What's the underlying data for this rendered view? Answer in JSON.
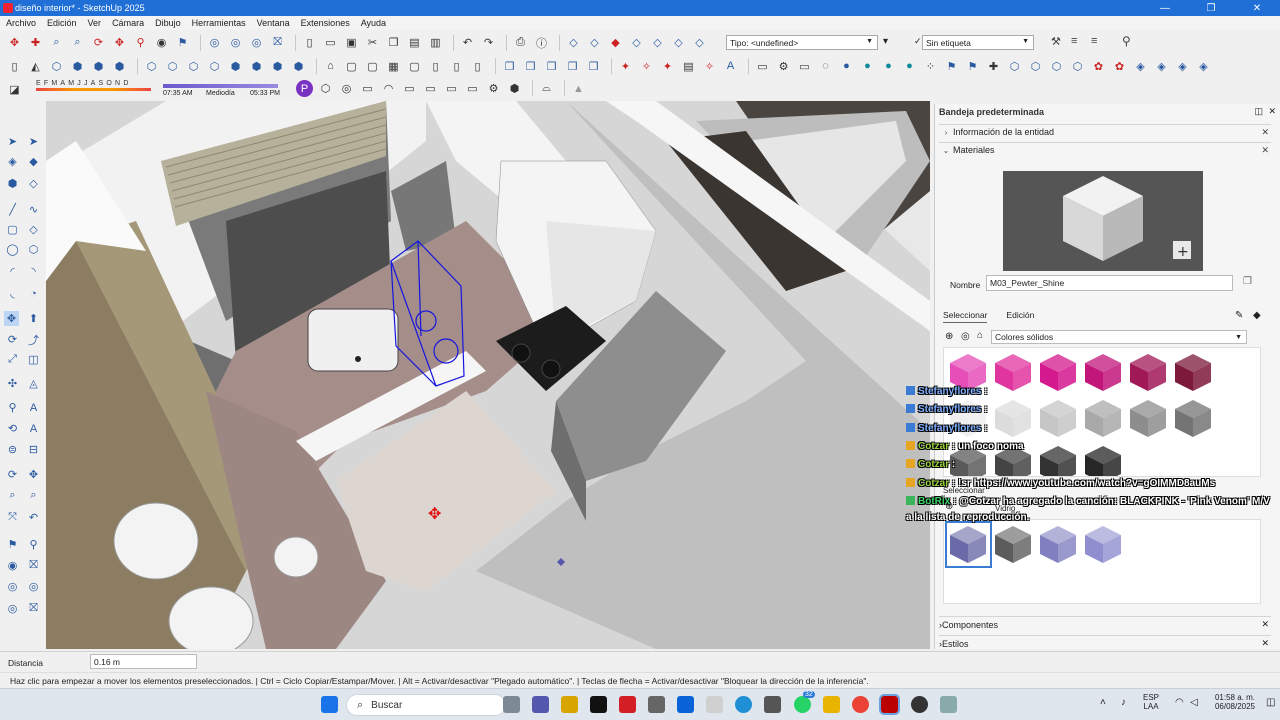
{
  "window": {
    "title": "diseño interior* - SketchUp 2025",
    "controls": [
      "—",
      "❐",
      "✕"
    ]
  },
  "menu": [
    "Archivo",
    "Edición",
    "Ver",
    "Cámara",
    "Dibujo",
    "Herramientas",
    "Ventana",
    "Extensiones",
    "Ayuda"
  ],
  "toolbar": {
    "type_combo": "Tipo: <undefined>",
    "tag_check": "✓",
    "tag_combo": "Sin etiqueta",
    "months": "EFMAMJJASOND",
    "time_start": "07:35 AM",
    "time_mid": "Mediodía",
    "time_end": "05:33 PM"
  },
  "tray": {
    "header": "Bandeja predeterminada",
    "entity_info": "Información de la entidad",
    "materials": "Materiales",
    "name_label": "Nombre",
    "name_value": "M03_Pewter_Shine",
    "tab_select": "Seleccionar",
    "tab_edit": "Edición",
    "collection": "Colores sólidos",
    "second_select": "Seleccionar",
    "second_collection": "Vidrio",
    "components": "Componentes",
    "styles": "Estilos"
  },
  "swatch_colors": [
    "#e64fb8",
    "#e0359f",
    "#d4188e",
    "#c2167a",
    "#a01856",
    "#7d1a3b",
    "#eeeeee",
    "#dcdcdc",
    "#c6c6c6",
    "#a9a9a9",
    "#8d8d8d",
    "#747474",
    "#5a5a5a",
    "#444444",
    "#333333",
    "#262626"
  ],
  "glass_colors": [
    "#6a6aa8",
    "#5c5c5c",
    "#8080c0",
    "#8f8fd0"
  ],
  "chat": [
    {
      "user": "Stefanyflores",
      "msg": " :",
      "badge": "b"
    },
    {
      "user": "Stefanyflores",
      "msg": " :",
      "badge": "b"
    },
    {
      "user": "Stefanyflores",
      "msg": " :",
      "badge": "b"
    },
    {
      "user": "Cotzar",
      "msg": " : un foco noma",
      "badge": "g"
    },
    {
      "user": "Cotzar",
      "msg": " :",
      "badge": "g"
    },
    {
      "user": "Cotzar",
      "msg": " : !sr https://www.youtube.com/watch?v=gOIMMD8auMs",
      "badge": "g"
    },
    {
      "user": "BotRix",
      "msg": " : @Cotzar ha agregado la canción: BLACKPINK - 'Pink Venom' M/V",
      "badge": "gr"
    },
    {
      "user": "",
      "msg": "a la lista de reproducción.",
      "badge": ""
    }
  ],
  "measure": {
    "label": "Distancia",
    "value": "0.16 m"
  },
  "status": "Haz clic para empezar a mover los elementos preseleccionados. | Ctrl = Ciclo Copiar/Estampar/Mover. | Alt = Activar/desactivar \"Plegado automático\". | Teclas de flecha = Activar/desactivar \"Bloquear la dirección de la inferencia\".",
  "taskbar": {
    "search": "Buscar",
    "lang": "ESP",
    "region": "LAA",
    "time": "01:58 a. m.",
    "date": "06/08/2025",
    "badge_count": "32"
  }
}
